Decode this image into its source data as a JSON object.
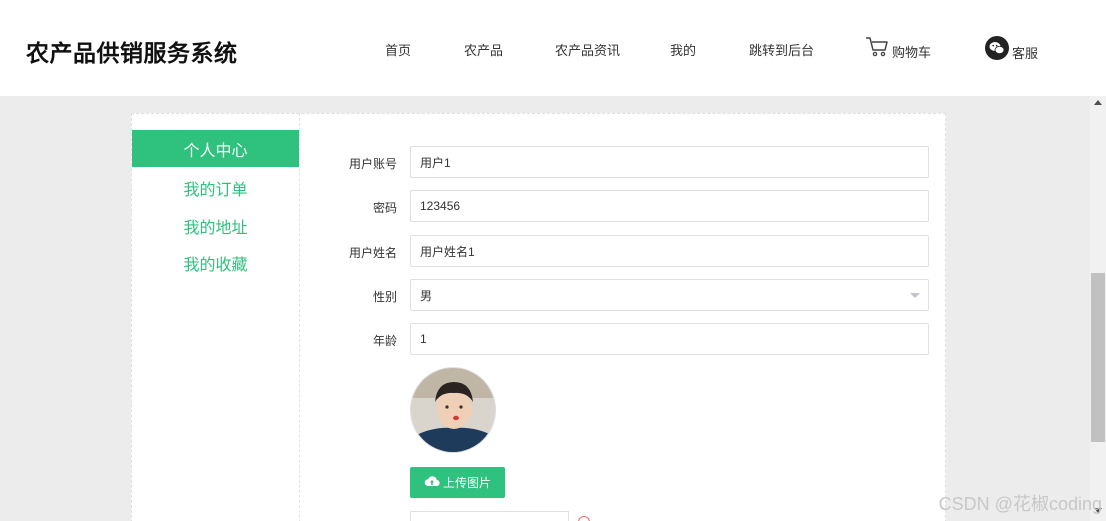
{
  "header": {
    "title": "农产品供销服务系统",
    "nav": {
      "home": "首页",
      "products": "农产品",
      "news": "农产品资讯",
      "mine": "我的",
      "backend": "跳转到后台",
      "cart": "购物车",
      "service": "客服"
    }
  },
  "sidebar": {
    "items": [
      {
        "label": "个人中心",
        "active": true
      },
      {
        "label": "我的订单"
      },
      {
        "label": "我的地址"
      },
      {
        "label": "我的收藏"
      }
    ]
  },
  "form": {
    "account_label": "用户账号",
    "account_value": "用户1",
    "password_label": "密码",
    "password_value": "123456",
    "name_label": "用户姓名",
    "name_value": "用户姓名1",
    "gender_label": "性别",
    "gender_value": "男",
    "age_label": "年龄",
    "age_value": "1",
    "upload_label": "上传图片"
  },
  "watermark": "CSDN @花椒coding",
  "colors": {
    "accent": "#2ec27e"
  },
  "icons": {
    "cart": "shopping-cart-icon",
    "service": "wechat-icon",
    "upload": "cloud-upload-icon"
  }
}
